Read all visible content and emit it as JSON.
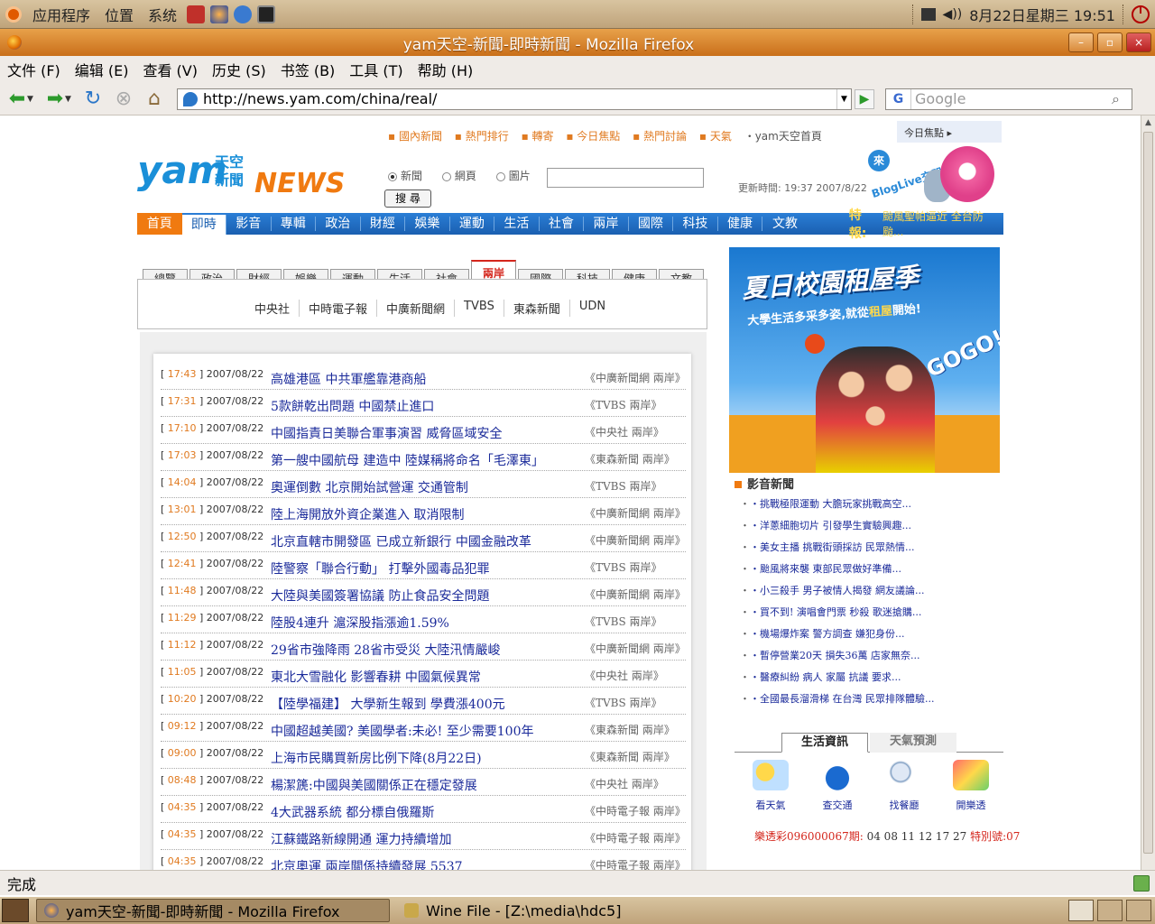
{
  "panel": {
    "apps": "应用程序",
    "places": "位置",
    "system": "系统",
    "clock": "8月22日星期三 19:51"
  },
  "window": {
    "title": "yam天空-新聞-即時新聞 - Mozilla Firefox",
    "minimize": "–",
    "maximize": "▫",
    "close": "×"
  },
  "menubar": [
    "文件 (F)",
    "编辑 (E)",
    "查看 (V)",
    "历史 (S)",
    "书签 (B)",
    "工具 (T)",
    "帮助 (H)"
  ],
  "toolbar": {
    "url": "http://news.yam.com/china/real/",
    "search_placeholder": "Google",
    "search_engine": "G"
  },
  "site": {
    "logo_word": "yam",
    "logo_tiankong": "天空",
    "logo_xinwen": "新聞",
    "logo_news": "NEWS",
    "top_links": [
      "▪ 國內新聞",
      "▪ 熱門排行",
      "▪ 轉寄",
      "▪ 今日焦點",
      "▪ 熱門討論",
      "▪ 天氣",
      "・yam天空首頁"
    ],
    "hot_box": "今日焦點 ▸",
    "search_options": [
      "新聞",
      "網頁",
      "圖片"
    ],
    "search_button": "搜 尋",
    "update_label": "更新時間:",
    "update_time": "19:37  2007/8/22",
    "blog_come": "來",
    "blog_text": "BlogLive交朋友"
  },
  "main_nav": [
    "首頁",
    "即時",
    "影音",
    "專輯",
    "政治",
    "財經",
    "娛樂",
    "運動",
    "生活",
    "社會",
    "兩岸",
    "國際",
    "科技",
    "健康",
    "文教"
  ],
  "special_label": "特報:",
  "special_text": "颱風聖帕逼近 全台防颱...",
  "sub_tabs": [
    "總覽",
    "政治",
    "財經",
    "娛樂",
    "運動",
    "生活",
    "社會",
    "兩岸",
    "國際",
    "科技",
    "健康",
    "文教"
  ],
  "sources": [
    "中央社",
    "中時電子報",
    "中廣新聞網",
    "TVBS",
    "東森新聞",
    "UDN"
  ],
  "news": [
    {
      "time": "17:43",
      "date": "2007/08/22",
      "title": "高雄港區 中共軍艦靠港商船",
      "src": "《中廣新聞網 兩岸》"
    },
    {
      "time": "17:31",
      "date": "2007/08/22",
      "title": "5款餅乾出問題 中國禁止進口",
      "src": "《TVBS 兩岸》"
    },
    {
      "time": "17:10",
      "date": "2007/08/22",
      "title": "中國指責日美聯合軍事演習 威脅區域安全",
      "src": "《中央社 兩岸》"
    },
    {
      "time": "17:03",
      "date": "2007/08/22",
      "title": "第一艘中國航母 建造中 陸媒稱將命名「毛澤東」",
      "src": "《東森新聞 兩岸》"
    },
    {
      "time": "14:04",
      "date": "2007/08/22",
      "title": "奧運倒數 北京開始試營運 交通管制",
      "src": "《TVBS 兩岸》"
    },
    {
      "time": "13:01",
      "date": "2007/08/22",
      "title": "陸上海開放外資企業進入 取消限制",
      "src": "《中廣新聞網 兩岸》"
    },
    {
      "time": "12:50",
      "date": "2007/08/22",
      "title": "北京直轄市開發區 已成立新銀行 中國金融改革",
      "src": "《中廣新聞網 兩岸》"
    },
    {
      "time": "12:41",
      "date": "2007/08/22",
      "title": "陸警察「聯合行動」 打擊外國毒品犯罪",
      "src": "《TVBS 兩岸》"
    },
    {
      "time": "11:48",
      "date": "2007/08/22",
      "title": "大陸與美國簽署協議 防止食品安全問題",
      "src": "《中廣新聞網 兩岸》"
    },
    {
      "time": "11:29",
      "date": "2007/08/22",
      "title": "陸股4連升 滬深股指漲逾1.59%",
      "src": "《TVBS 兩岸》"
    },
    {
      "time": "11:12",
      "date": "2007/08/22",
      "title": "29省市強降雨 28省市受災 大陸汛情嚴峻",
      "src": "《中廣新聞網 兩岸》"
    },
    {
      "time": "11:05",
      "date": "2007/08/22",
      "title": "東北大雪融化 影響春耕 中國氣候異常",
      "src": "《中央社 兩岸》"
    },
    {
      "time": "10:20",
      "date": "2007/08/22",
      "title": "【陸學福建】 大學新生報到 學費漲400元",
      "src": "《TVBS 兩岸》"
    },
    {
      "time": "09:12",
      "date": "2007/08/22",
      "title": "中國超越美國? 美國學者:未必! 至少需要100年",
      "src": "《東森新聞 兩岸》"
    },
    {
      "time": "09:00",
      "date": "2007/08/22",
      "title": "上海市民購買新房比例下降(8月22日)",
      "src": "《東森新聞 兩岸》"
    },
    {
      "time": "08:48",
      "date": "2007/08/22",
      "title": "楊潔篪:中國與美國關係正在穩定發展",
      "src": "《中央社 兩岸》"
    },
    {
      "time": "04:35",
      "date": "2007/08/22",
      "title": "4大武器系統 都分標自俄羅斯",
      "src": "《中時電子報 兩岸》"
    },
    {
      "time": "04:35",
      "date": "2007/08/22",
      "title": "江蘇鐵路新線開通 運力持續增加",
      "src": "《中時電子報 兩岸》"
    },
    {
      "time": "04:35",
      "date": "2007/08/22",
      "title": "北京奧運 兩岸關係持續發展 5537",
      "src": "《中時電子報 兩岸》"
    }
  ],
  "banner": {
    "title": "夏日校園租屋季",
    "subtitle_a": "大學生活多采多姿,就從",
    "subtitle_b": "租屋",
    "subtitle_c": "開始!",
    "go": "GOGO!"
  },
  "video": {
    "title": "影音新聞",
    "items": [
      "・挑戰極限運動 大膽玩家挑戰高空...",
      "・洋蔥細胞切片 引發學生實驗興趣...",
      "・美女主播 挑戰街頭採訪 民眾熱情...",
      "・颱風將來襲 東部民眾做好準備...",
      "・小三殺手 男子被情人揭發 網友議論...",
      "・買不到! 演唱會門票 秒殺 歌迷搶購...",
      "・機場爆炸案 警方調查 嫌犯身份...",
      "・暫停營業20天 損失36萬 店家無奈...",
      "・醫療糾紛 病人 家屬 抗議 要求...",
      "・全國最長溜滑梯 在台灣 民眾排隊體驗..."
    ]
  },
  "life": {
    "tab_on": "生活資訊",
    "tab_off": "天氣預測",
    "icons": [
      "看天氣",
      "查交通",
      "找餐廳",
      "開樂透"
    ],
    "lottery_label": "樂透彩096000067期:",
    "lottery_nums": "04 08 11 12 17 27",
    "lottery_special": "特別號:07"
  },
  "statusbar": {
    "text": "完成"
  },
  "taskbar": {
    "firefox": "yam天空-新聞-即時新聞 - Mozilla Firefox",
    "wine": "Wine File - [Z:\\media\\hdc5]"
  }
}
